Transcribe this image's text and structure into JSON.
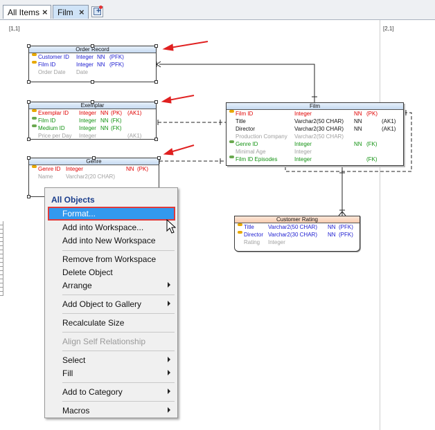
{
  "tabs": [
    {
      "label": "All Items",
      "close": "×"
    },
    {
      "label": "Film",
      "close": "×"
    }
  ],
  "canvas": {
    "page_coords": [
      "[1,1]",
      "[2,1]"
    ]
  },
  "entities": {
    "order_record": {
      "title": "Order Record",
      "rows": [
        {
          "name": "Customer ID",
          "type": "Integer",
          "nn": "NN",
          "key": "(PFK)"
        },
        {
          "name": "Film ID",
          "type": "Integer",
          "nn": "NN",
          "key": "(PFK)"
        },
        {
          "name": "Order Date",
          "type": "Date",
          "nn": "",
          "key": ""
        }
      ]
    },
    "exemplar": {
      "title": "Exemplar",
      "rows": [
        {
          "name": "Exemplar ID",
          "type": "Integer",
          "nn": "NN",
          "key": "(PK)",
          "extra": "(AK1)"
        },
        {
          "name": "Film ID",
          "type": "Integer",
          "nn": "NN",
          "key": "(FK)",
          "extra": ""
        },
        {
          "name": "Medium ID",
          "type": "Integer",
          "nn": "NN",
          "key": "(FK)",
          "extra": ""
        },
        {
          "name": "Price per Day",
          "type": "Integer",
          "nn": "",
          "key": "",
          "extra": "(AK1)"
        }
      ]
    },
    "genre": {
      "title": "Genre",
      "rows": [
        {
          "name": "Genre ID",
          "type": "Integer",
          "nn": "NN",
          "key": "(PK)"
        },
        {
          "name": "Name",
          "type": "Varchar2(20 CHAR)",
          "nn": "",
          "key": ""
        }
      ]
    },
    "film": {
      "title": "Film",
      "rows": [
        {
          "name": "Film ID",
          "type": "Integer",
          "nn": "NN",
          "key": "(PK)",
          "extra": ""
        },
        {
          "name": "Title",
          "type": "Varchar2(50 CHAR)",
          "nn": "NN",
          "key": "",
          "extra": "(AK1)"
        },
        {
          "name": "Director",
          "type": "Varchar2(30 CHAR)",
          "nn": "NN",
          "key": "",
          "extra": "(AK1)"
        },
        {
          "name": "Production Company",
          "type": "Varchar2(50 CHAR)",
          "nn": "",
          "key": "",
          "extra": ""
        },
        {
          "name": "Genre ID",
          "type": "Integer",
          "nn": "NN",
          "key": "(FK)",
          "extra": ""
        },
        {
          "name": "Minimal Age",
          "type": "Integer",
          "nn": "",
          "key": "",
          "extra": ""
        },
        {
          "name": "Film ID Episodes",
          "type": "Integer",
          "nn": "",
          "key": "(FK)",
          "extra": ""
        }
      ]
    },
    "customer_rating": {
      "title": "Customer Rating",
      "rows": [
        {
          "name": "Title",
          "type": "Varchar2(50 CHAR)",
          "nn": "NN",
          "key": "(PFK)"
        },
        {
          "name": "Director",
          "type": "Varchar2(30 CHAR)",
          "nn": "NN",
          "key": "(PFK)"
        },
        {
          "name": "Rating",
          "type": "Integer",
          "nn": "",
          "key": ""
        }
      ]
    }
  },
  "context_menu": {
    "title": "All Objects",
    "items": [
      {
        "label": "Format...",
        "selected": true
      },
      {
        "label": "Add into Workspace..."
      },
      {
        "label": "Add into New Workspace"
      },
      {
        "label": "Remove from Workspace"
      },
      {
        "label": "Delete Object"
      },
      {
        "label": "Arrange",
        "submenu": true
      },
      {
        "label": "Add Object to Gallery",
        "submenu": true
      },
      {
        "label": "Recalculate Size"
      },
      {
        "label": "Align Self Relationship",
        "disabled": true
      },
      {
        "label": "Select",
        "submenu": true
      },
      {
        "label": "Fill",
        "submenu": true
      },
      {
        "label": "Add to Category",
        "submenu": true
      },
      {
        "label": "Macros",
        "submenu": true
      }
    ]
  },
  "colors": {
    "annotation_arrow": "#e02020",
    "pk": "#e00000",
    "pfk": "#1a1ad0",
    "fk": "#129212",
    "attr": "#111111",
    "optional": "#a0a0a0",
    "menu_highlight": "#3399ee",
    "menu_highlight_border": "#e03a3a"
  }
}
